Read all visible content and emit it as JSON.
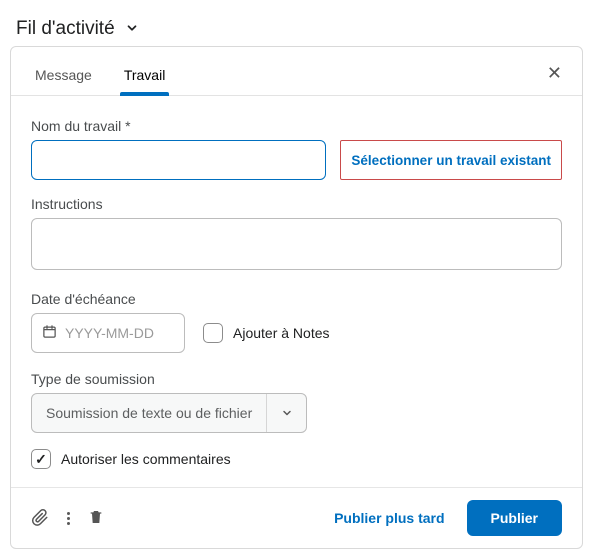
{
  "header": {
    "title": "Fil d'activité"
  },
  "tabs": {
    "message": "Message",
    "travail": "Travail"
  },
  "fields": {
    "name_label": "Nom du travail *",
    "select_existing": "Sélectionner un travail existant",
    "instructions_label": "Instructions",
    "due_label": "Date d'échéance",
    "date_placeholder": "YYYY-MM-DD",
    "add_to_notes": "Ajouter à Notes",
    "submission_type_label": "Type de soumission",
    "submission_type_value": "Soumission de texte ou de fichier",
    "allow_comments": "Autoriser les commentaires"
  },
  "footer": {
    "later": "Publier plus tard",
    "publish": "Publier"
  }
}
